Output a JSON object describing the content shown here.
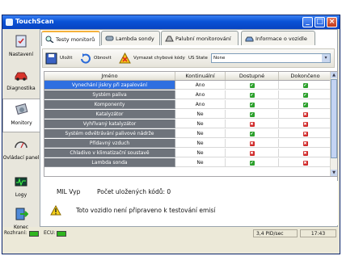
{
  "window": {
    "title": "TouchScan"
  },
  "sidebar": {
    "items": [
      {
        "label": "Nastavení",
        "icon": "settings-icon"
      },
      {
        "label": "Diagnostika",
        "icon": "car-diagnostics-icon"
      },
      {
        "label": "Monitory",
        "icon": "monitors-icon"
      },
      {
        "label": "Ovládací panel",
        "icon": "dashboard-icon"
      },
      {
        "label": "Logy",
        "icon": "logs-icon"
      },
      {
        "label": "Konec",
        "icon": "exit-icon"
      }
    ]
  },
  "tabs": [
    {
      "label": "Testy monitorů",
      "icon": "magnifier-icon"
    },
    {
      "label": "Lambda sondy",
      "icon": "lambda-sensor-icon"
    },
    {
      "label": "Palubní monitorování",
      "icon": "onboard-monitor-icon"
    },
    {
      "label": "Informace o vozidle",
      "icon": "vehicle-info-icon"
    }
  ],
  "toolbar": {
    "save_label": "Uložit",
    "refresh_label": "Obnovit",
    "clear_codes_label": "Vymazat chybové kódy",
    "us_state_label": "US State",
    "us_state_value": "None"
  },
  "table": {
    "columns": [
      "Jméno",
      "Kontinuální",
      "Dostupné",
      "Dokončeno"
    ],
    "rows": [
      {
        "name": "Vynechání jiskry při zapalování",
        "continuous": "Ano",
        "available": "ok",
        "completed": "ok",
        "selected": true
      },
      {
        "name": "Systém paliva",
        "continuous": "Ano",
        "available": "ok",
        "completed": "ok"
      },
      {
        "name": "Komponenty",
        "continuous": "Ano",
        "available": "ok",
        "completed": "ok"
      },
      {
        "name": "Katalyzátor",
        "continuous": "Ne",
        "available": "ok",
        "completed": "bad"
      },
      {
        "name": "Vyhřívaný katalyzátor",
        "continuous": "Ne",
        "available": "bad",
        "completed": "bad"
      },
      {
        "name": "Systém odvětrávání palivové nádrže",
        "continuous": "Ne",
        "available": "ok",
        "completed": "bad"
      },
      {
        "name": "Přídavný vzduch",
        "continuous": "Ne",
        "available": "bad",
        "completed": "bad"
      },
      {
        "name": "Chladivo v klimatizační soustavě",
        "continuous": "Ne",
        "available": "bad",
        "completed": "bad"
      },
      {
        "name": "Lambda sonda",
        "continuous": "Ne",
        "available": "ok",
        "completed": "bad"
      }
    ]
  },
  "info": {
    "mil": "MIL Vyp",
    "stored_codes": "Počet uložených kódů: 0",
    "warning": "Toto vozidlo není připraveno k testování emisí"
  },
  "status": {
    "interface_label": "Rozhraní:",
    "ecu_label": "ECU:",
    "rate": "3,4 PID/sec",
    "time": "17:43"
  },
  "colors": {
    "ok": "#2ca02c",
    "bad": "#d02a2a",
    "selected": "#2f6fe0",
    "name_cell": "#6e737b"
  }
}
